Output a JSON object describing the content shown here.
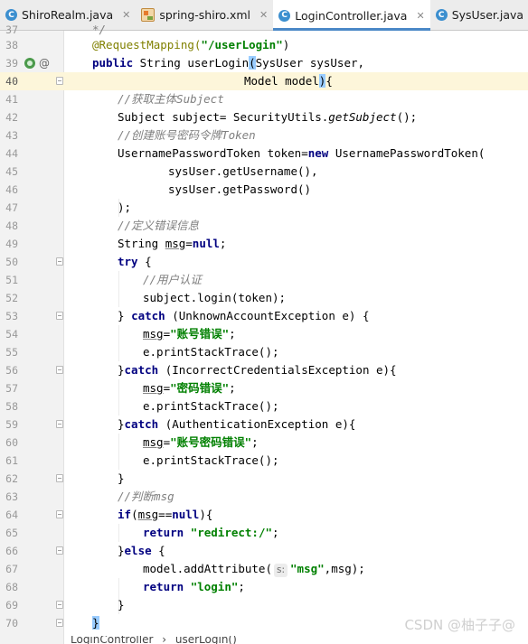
{
  "tabs": [
    {
      "label": "ShiroRealm.java",
      "icon": "java-class-icon",
      "active": false
    },
    {
      "label": "spring-shiro.xml",
      "icon": "xml-file-icon",
      "active": false
    },
    {
      "label": "LoginController.java",
      "icon": "java-class-icon",
      "active": true
    },
    {
      "label": "SysUser.java",
      "icon": "java-class-icon",
      "active": false
    }
  ],
  "editor": {
    "current_line": 40,
    "lines": [
      {
        "n": "37",
        "top_text": "/"
      },
      {
        "n": "38"
      },
      {
        "n": "39"
      },
      {
        "n": "40"
      },
      {
        "n": "41"
      },
      {
        "n": "42"
      },
      {
        "n": "43"
      },
      {
        "n": "44"
      },
      {
        "n": "45"
      },
      {
        "n": "46"
      },
      {
        "n": "47"
      },
      {
        "n": "48"
      },
      {
        "n": "49"
      },
      {
        "n": "50"
      },
      {
        "n": "51"
      },
      {
        "n": "52"
      },
      {
        "n": "53"
      },
      {
        "n": "54"
      },
      {
        "n": "55"
      },
      {
        "n": "56"
      },
      {
        "n": "57"
      },
      {
        "n": "58"
      },
      {
        "n": "59"
      },
      {
        "n": "60"
      },
      {
        "n": "61"
      },
      {
        "n": "62"
      },
      {
        "n": "63"
      },
      {
        "n": "64"
      },
      {
        "n": "65"
      },
      {
        "n": "66"
      },
      {
        "n": "67"
      },
      {
        "n": "68"
      },
      {
        "n": "69"
      },
      {
        "n": "70"
      }
    ],
    "code": {
      "l37": "*/",
      "l38_annotation": "@RequestMapping(",
      "l38_string": "\"/userLogin\"",
      "l38_close": ")",
      "l39_kw": "public",
      "l39_rest_a": " String userLogin",
      "l39_paren": "(",
      "l39_rest_b": "SysUser sysUser,",
      "l40_rest": "Model model",
      "l40_paren": ")",
      "l40_brace": "{",
      "l41": "//获取主体Subject",
      "l42_a": "Subject subject= SecurityUtils.",
      "l42_method": "getSubject",
      "l42_b": "();",
      "l43": "//创建账号密码令牌Token",
      "l44_a": "UsernamePasswordToken token=",
      "l44_kw": "new",
      "l44_b": " UsernamePasswordToken(",
      "l45": "sysUser.getUsername(),",
      "l46": "sysUser.getPassword()",
      "l47": ");",
      "l48": "//定义错误信息",
      "l49_a": "String ",
      "l49_var": "msg",
      "l49_b": "=",
      "l49_kw": "null",
      "l49_c": ";",
      "l50_kw": "try",
      "l50_b": " {",
      "l51": "//用户认证",
      "l52": "subject.login(token);",
      "l53_a": "} ",
      "l53_kw": "catch",
      "l53_b": " (UnknownAccountException e) {",
      "l54_var": "msg",
      "l54_b": "=",
      "l54_str": "\"账号错误\"",
      "l54_c": ";",
      "l55": "e.printStackTrace();",
      "l56_a": "}",
      "l56_kw": "catch",
      "l56_b": " (IncorrectCredentialsException e){",
      "l57_var": "msg",
      "l57_b": "=",
      "l57_str": "\"密码错误\"",
      "l57_c": ";",
      "l58": "e.printStackTrace();",
      "l59_a": "}",
      "l59_kw": "catch",
      "l59_b": " (AuthenticationException e){",
      "l60_var": "msg",
      "l60_b": "=",
      "l60_str": "\"账号密码错误\"",
      "l60_c": ";",
      "l61": "e.printStackTrace();",
      "l62": "}",
      "l63": "//判断msg",
      "l64_kw": "if",
      "l64_a": "(",
      "l64_var": "msg",
      "l64_b": "==",
      "l64_kw2": "null",
      "l64_c": "){",
      "l65_kw": "return",
      "l65_str": "\"redirect:/\"",
      "l65_c": ";",
      "l66_a": "}",
      "l66_kw": "else",
      "l66_b": " {",
      "l67_a": "model.addAttribute(",
      "l67_hint": "s:",
      "l67_str": "\"msg\"",
      "l67_b": ",",
      "l67_var": "msg",
      "l67_c": ");",
      "l68_kw": "return",
      "l68_str": "\"login\"",
      "l68_c": ";",
      "l69": "}",
      "l70": "}"
    }
  },
  "breadcrumb": {
    "items": [
      "LoginController",
      "userLogin()"
    ],
    "separator": "›"
  },
  "watermark": "CSDN @柚子子@"
}
